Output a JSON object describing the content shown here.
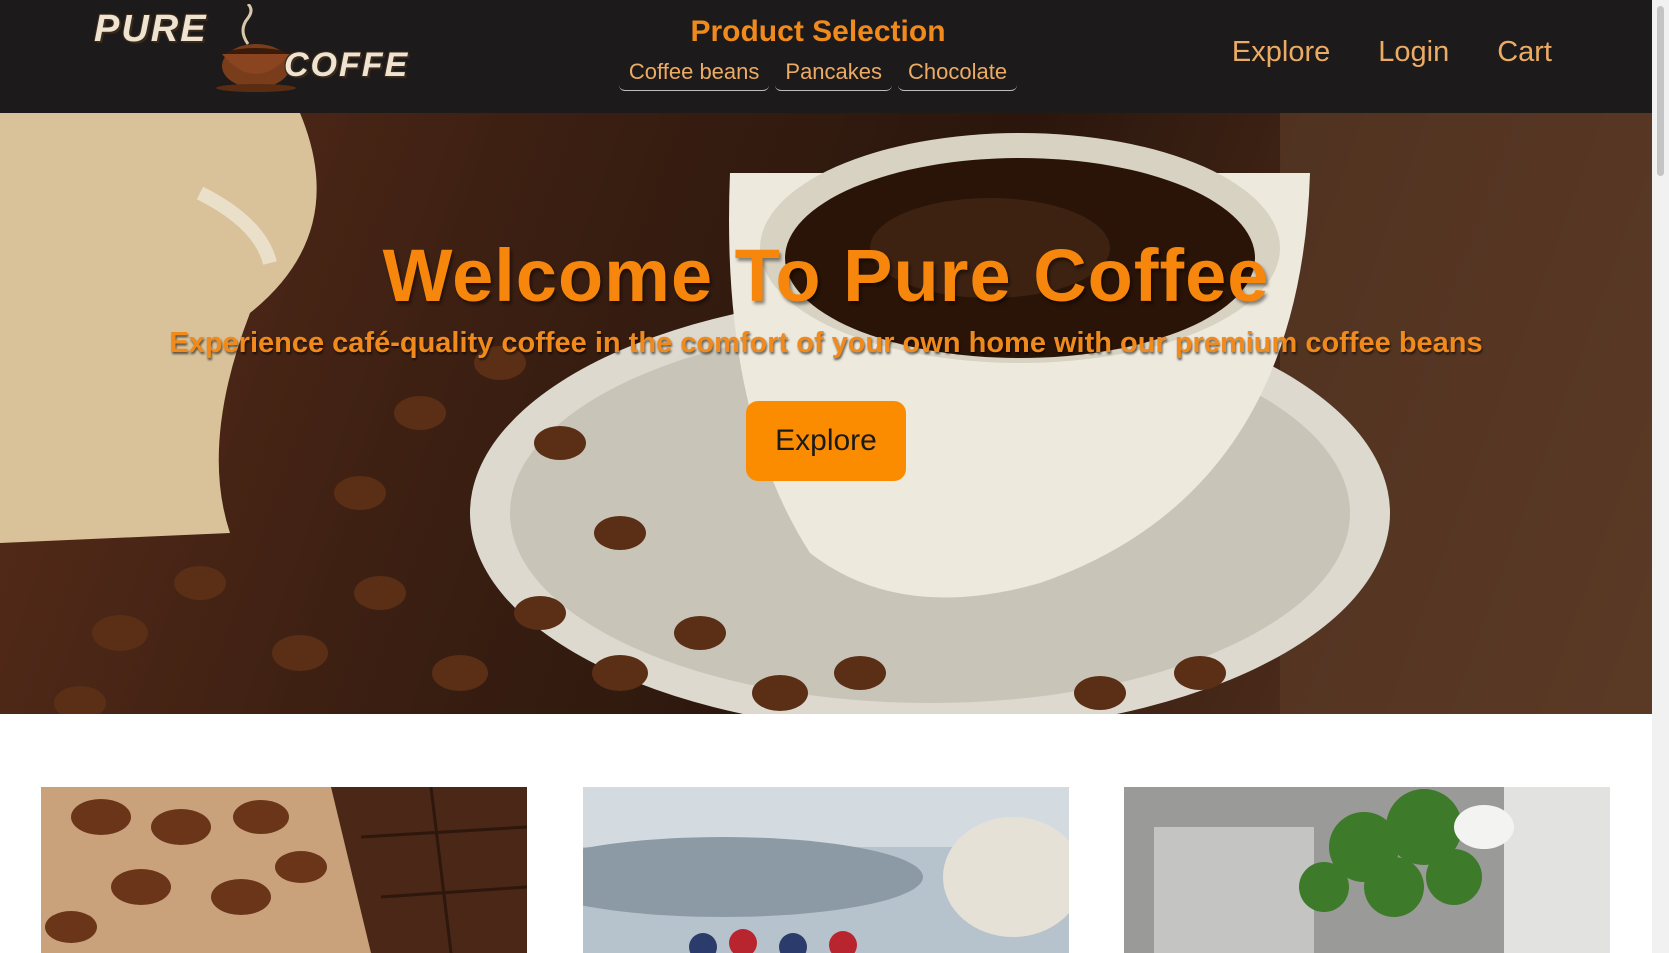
{
  "header": {
    "logo": {
      "word1": "PURE",
      "word2": "COFFE"
    },
    "product_selection": {
      "title": "Product Selection",
      "items": [
        "Coffee beans",
        "Pancakes",
        "Chocolate"
      ]
    },
    "nav": [
      "Explore",
      "Login",
      "Cart"
    ]
  },
  "hero": {
    "title": "Welcome To Pure Coffee",
    "subtitle": "Experience café-quality coffee in the comfort of your own home with our premium coffee beans",
    "button_label": "Explore"
  },
  "colors": {
    "header_bg": "#1c1a1a",
    "accent_orange": "#f7870c",
    "nav_text": "#ecab64",
    "button_bg": "#fb8c00"
  }
}
